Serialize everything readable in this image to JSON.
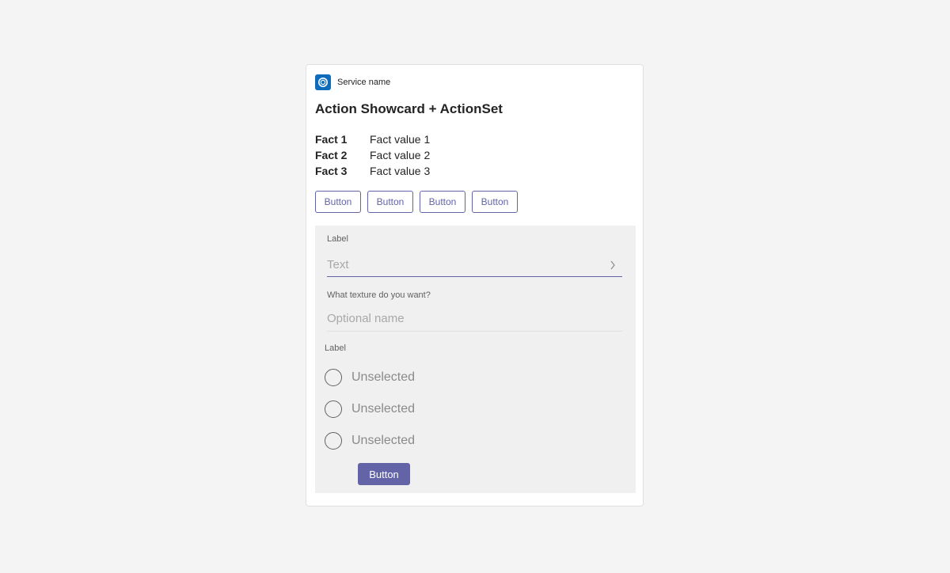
{
  "header": {
    "service_name": "Service name",
    "icon": "service-app-icon",
    "icon_color": "#0f6cbd"
  },
  "title": "Action Showcard + ActionSet",
  "facts": [
    {
      "key": "Fact 1",
      "value": "Fact value 1"
    },
    {
      "key": "Fact 2",
      "value": "Fact value 2"
    },
    {
      "key": "Fact 3",
      "value": "Fact value 3"
    }
  ],
  "actions": [
    "Button",
    "Button",
    "Button",
    "Button"
  ],
  "showcard": {
    "input1": {
      "label": "Label",
      "placeholder": "Text",
      "icon": "chevron-right-icon"
    },
    "input2": {
      "label": "What texture do you want?",
      "placeholder": "Optional name"
    },
    "choice_set": {
      "label": "Label",
      "options": [
        "Unselected",
        "Unselected",
        "Unselected"
      ]
    },
    "submit_label": "Button"
  },
  "colors": {
    "accent": "#6264a7",
    "background": "#f4f4f4",
    "showcard_bg": "#f0f0f0"
  }
}
